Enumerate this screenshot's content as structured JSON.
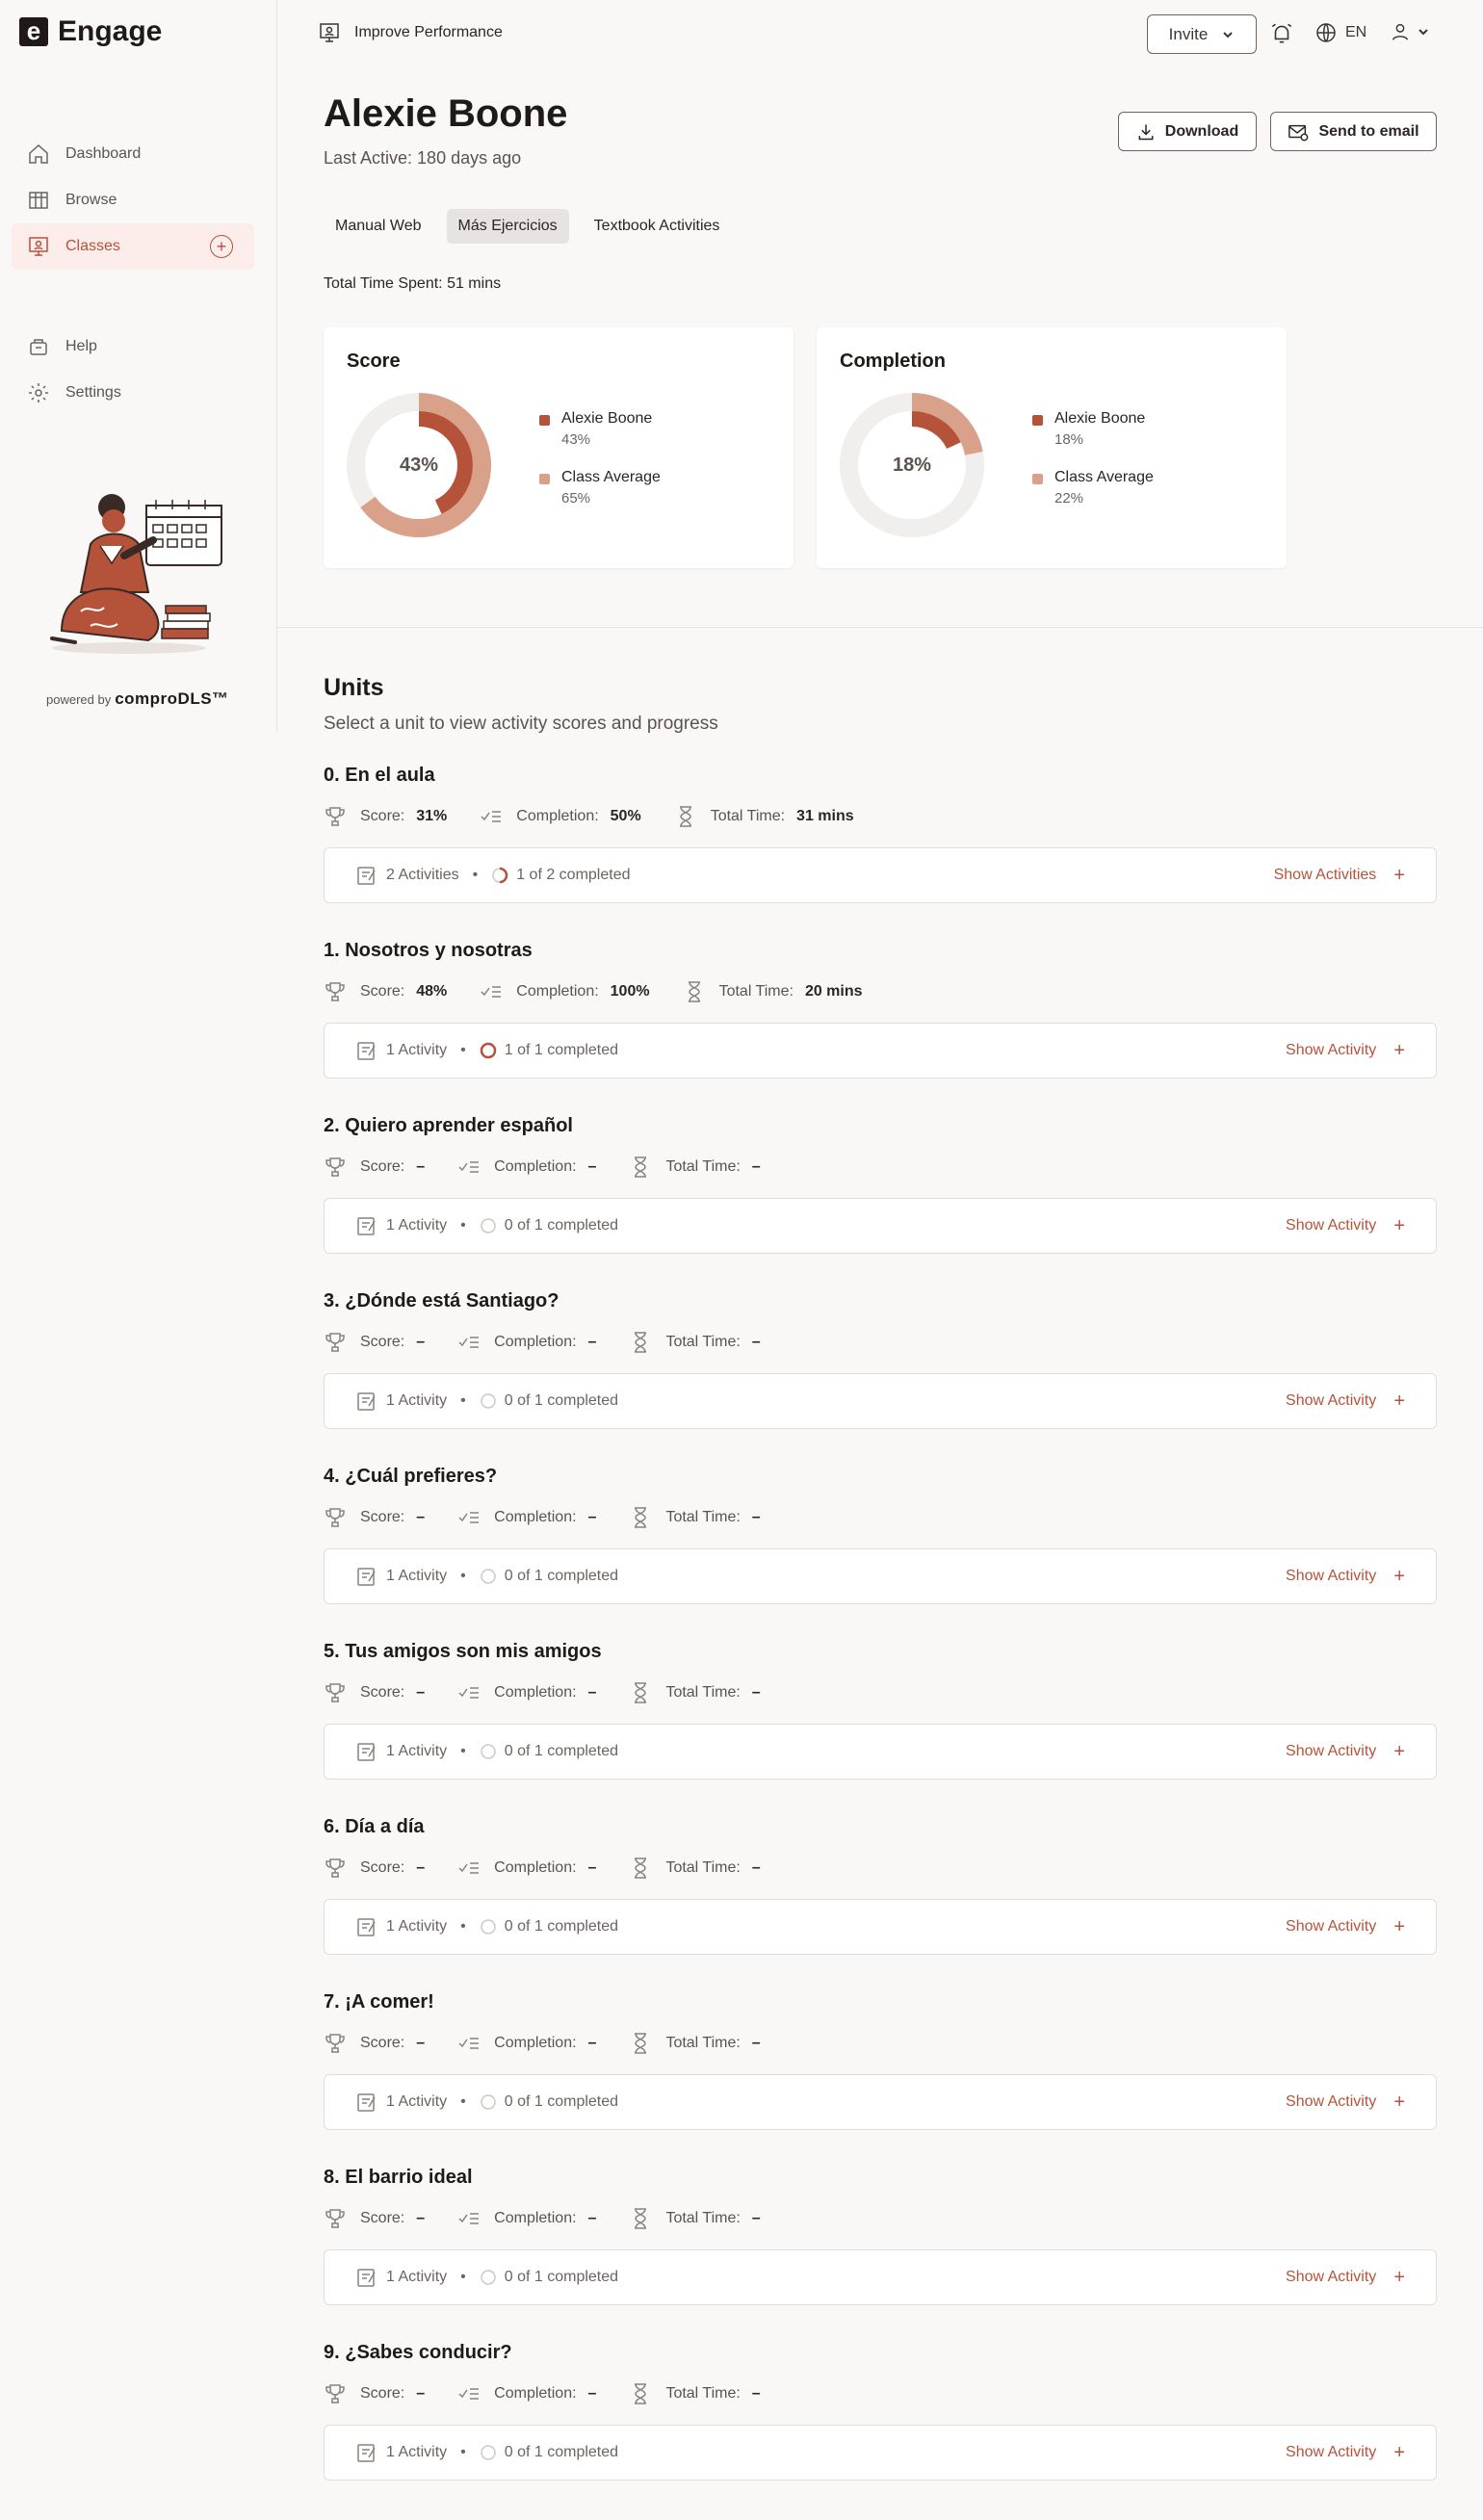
{
  "app": {
    "name": "Engage",
    "logo_letter": "e"
  },
  "sidebar": {
    "items": [
      {
        "label": "Dashboard",
        "icon": "home-icon"
      },
      {
        "label": "Browse",
        "icon": "grid-icon"
      },
      {
        "label": "Classes",
        "icon": "presentation-icon",
        "active": true
      },
      {
        "label": "Help",
        "icon": "help-icon"
      },
      {
        "label": "Settings",
        "icon": "gear-icon"
      }
    ],
    "powered_prefix": "powered by",
    "powered_brand": "comproDLS™"
  },
  "topbar": {
    "breadcrumb": "Improve Performance",
    "invite": "Invite",
    "language": "EN"
  },
  "profile": {
    "name": "Alexie Boone",
    "last_active": "Last Active: 180 days ago",
    "download": "Download",
    "send_email": "Send to email",
    "tabs": [
      "Manual Web",
      "Más Ejercicios",
      "Textbook Activities"
    ],
    "active_tab": 1,
    "total_time": "Total Time Spent: 51 mins"
  },
  "cards": {
    "score": {
      "title": "Score",
      "center": "43%",
      "student_label": "Alexie Boone",
      "student_value": "43%",
      "avg_label": "Class Average",
      "avg_value": "65%",
      "student_pct": 43,
      "avg_pct": 65
    },
    "completion": {
      "title": "Completion",
      "center": "18%",
      "student_label": "Alexie Boone",
      "student_value": "18%",
      "avg_label": "Class Average",
      "avg_value": "22%",
      "student_pct": 18,
      "avg_pct": 22
    }
  },
  "colors": {
    "accent": "#b4533a",
    "student": "#b4533a",
    "average": "#d9a08a",
    "track": "#f1efed"
  },
  "units_section": {
    "title": "Units",
    "subtitle": "Select a unit to view activity scores and progress"
  },
  "units": [
    {
      "title": "0. En el aula",
      "score_label": "Score:",
      "score": "31%",
      "completion_label": "Completion:",
      "completion": "50%",
      "time_label": "Total Time:",
      "time": "31 mins",
      "activities": "2 Activities",
      "completed": "1 of 2 completed",
      "progress": 0.5,
      "action": "Show Activities"
    },
    {
      "title": "1. Nosotros y nosotras",
      "score_label": "Score:",
      "score": "48%",
      "completion_label": "Completion:",
      "completion": "100%",
      "time_label": "Total Time:",
      "time": "20 mins",
      "activities": "1 Activity",
      "completed": "1 of 1 completed",
      "progress": 1,
      "action": "Show Activity"
    },
    {
      "title": "2. Quiero aprender español",
      "score_label": "Score:",
      "score": "–",
      "completion_label": "Completion:",
      "completion": "–",
      "time_label": "Total Time:",
      "time": "–",
      "activities": "1 Activity",
      "completed": "0 of 1 completed",
      "progress": 0,
      "action": "Show Activity"
    },
    {
      "title": "3. ¿Dónde está Santiago?",
      "score_label": "Score:",
      "score": "–",
      "completion_label": "Completion:",
      "completion": "–",
      "time_label": "Total Time:",
      "time": "–",
      "activities": "1 Activity",
      "completed": "0 of 1 completed",
      "progress": 0,
      "action": "Show Activity"
    },
    {
      "title": "4. ¿Cuál prefieres?",
      "score_label": "Score:",
      "score": "–",
      "completion_label": "Completion:",
      "completion": "–",
      "time_label": "Total Time:",
      "time": "–",
      "activities": "1 Activity",
      "completed": "0 of 1 completed",
      "progress": 0,
      "action": "Show Activity"
    },
    {
      "title": "5. Tus amigos son mis amigos",
      "score_label": "Score:",
      "score": "–",
      "completion_label": "Completion:",
      "completion": "–",
      "time_label": "Total Time:",
      "time": "–",
      "activities": "1 Activity",
      "completed": "0 of 1 completed",
      "progress": 0,
      "action": "Show Activity"
    },
    {
      "title": "6. Día a día",
      "score_label": "Score:",
      "score": "–",
      "completion_label": "Completion:",
      "completion": "–",
      "time_label": "Total Time:",
      "time": "–",
      "activities": "1 Activity",
      "completed": "0 of 1 completed",
      "progress": 0,
      "action": "Show Activity"
    },
    {
      "title": "7. ¡A comer!",
      "score_label": "Score:",
      "score": "–",
      "completion_label": "Completion:",
      "completion": "–",
      "time_label": "Total Time:",
      "time": "–",
      "activities": "1 Activity",
      "completed": "0 of 1 completed",
      "progress": 0,
      "action": "Show Activity"
    },
    {
      "title": "8. El barrio ideal",
      "score_label": "Score:",
      "score": "–",
      "completion_label": "Completion:",
      "completion": "–",
      "time_label": "Total Time:",
      "time": "–",
      "activities": "1 Activity",
      "completed": "0 of 1 completed",
      "progress": 0,
      "action": "Show Activity"
    },
    {
      "title": "9. ¿Sabes conducir?",
      "score_label": "Score:",
      "score": "–",
      "completion_label": "Completion:",
      "completion": "–",
      "time_label": "Total Time:",
      "time": "–",
      "activities": "1 Activity",
      "completed": "0 of 1 completed",
      "progress": 0,
      "action": "Show Activity"
    }
  ]
}
